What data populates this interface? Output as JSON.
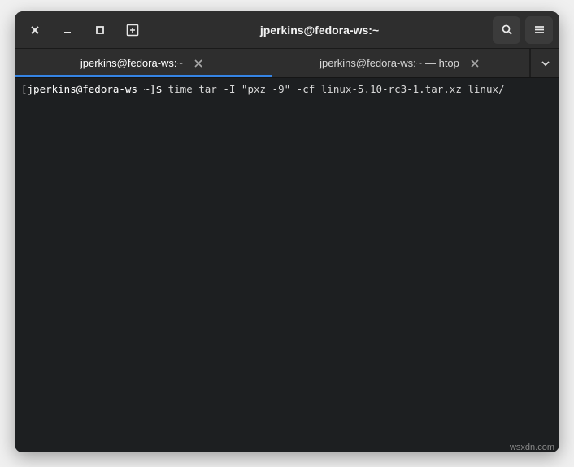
{
  "window": {
    "title": "jperkins@fedora-ws:~"
  },
  "tabs": [
    {
      "label": "jperkins@fedora-ws:~",
      "active": true
    },
    {
      "label": "jperkins@fedora-ws:~ — htop",
      "active": false
    }
  ],
  "terminal": {
    "prompt": "[jperkins@fedora-ws ~]$",
    "command": "time tar -I \"pxz -9\" -cf linux-5.10-rc3-1.tar.xz linux/"
  },
  "watermark": "wsxdn.com"
}
